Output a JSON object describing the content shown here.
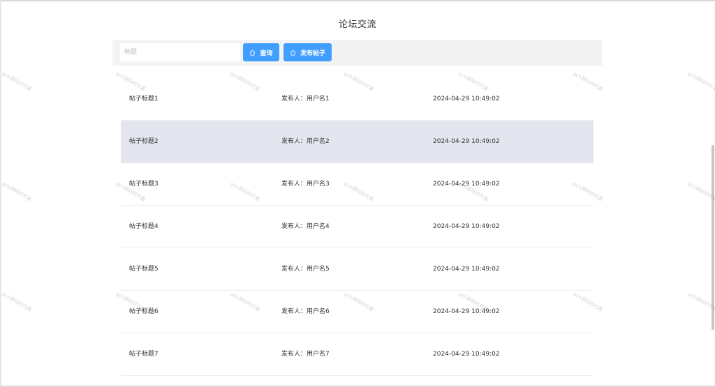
{
  "page": {
    "title": "论坛交流"
  },
  "toolbar": {
    "search_placeholder": "标题",
    "search_value": "",
    "search_button_label": "查询",
    "post_button_label": "发布帖子",
    "accent_color": "#409eff"
  },
  "posts": [
    {
      "title": "帖子标题1",
      "author": "发布人：用户名1",
      "time": "2024-04-29 10:49:02",
      "highlighted": false
    },
    {
      "title": "帖子标题2",
      "author": "发布人：用户名2",
      "time": "2024-04-29 10:49:02",
      "highlighted": true
    },
    {
      "title": "帖子标题3",
      "author": "发布人：用户名3",
      "time": "2024-04-29 10:49:02",
      "highlighted": false
    },
    {
      "title": "帖子标题4",
      "author": "发布人：用户名4",
      "time": "2024-04-29 10:49:02",
      "highlighted": false
    },
    {
      "title": "帖子标题5",
      "author": "发布人：用户名5",
      "time": "2024-04-29 10:49:02",
      "highlighted": false
    },
    {
      "title": "帖子标题6",
      "author": "发布人：用户名6",
      "time": "2024-04-29 10:49:02",
      "highlighted": false
    },
    {
      "title": "帖子标题7",
      "author": "发布人：用户名7",
      "time": "2024-04-29 10:49:02",
      "highlighted": false
    }
  ],
  "watermark": {
    "text": "gch源码时代者"
  }
}
